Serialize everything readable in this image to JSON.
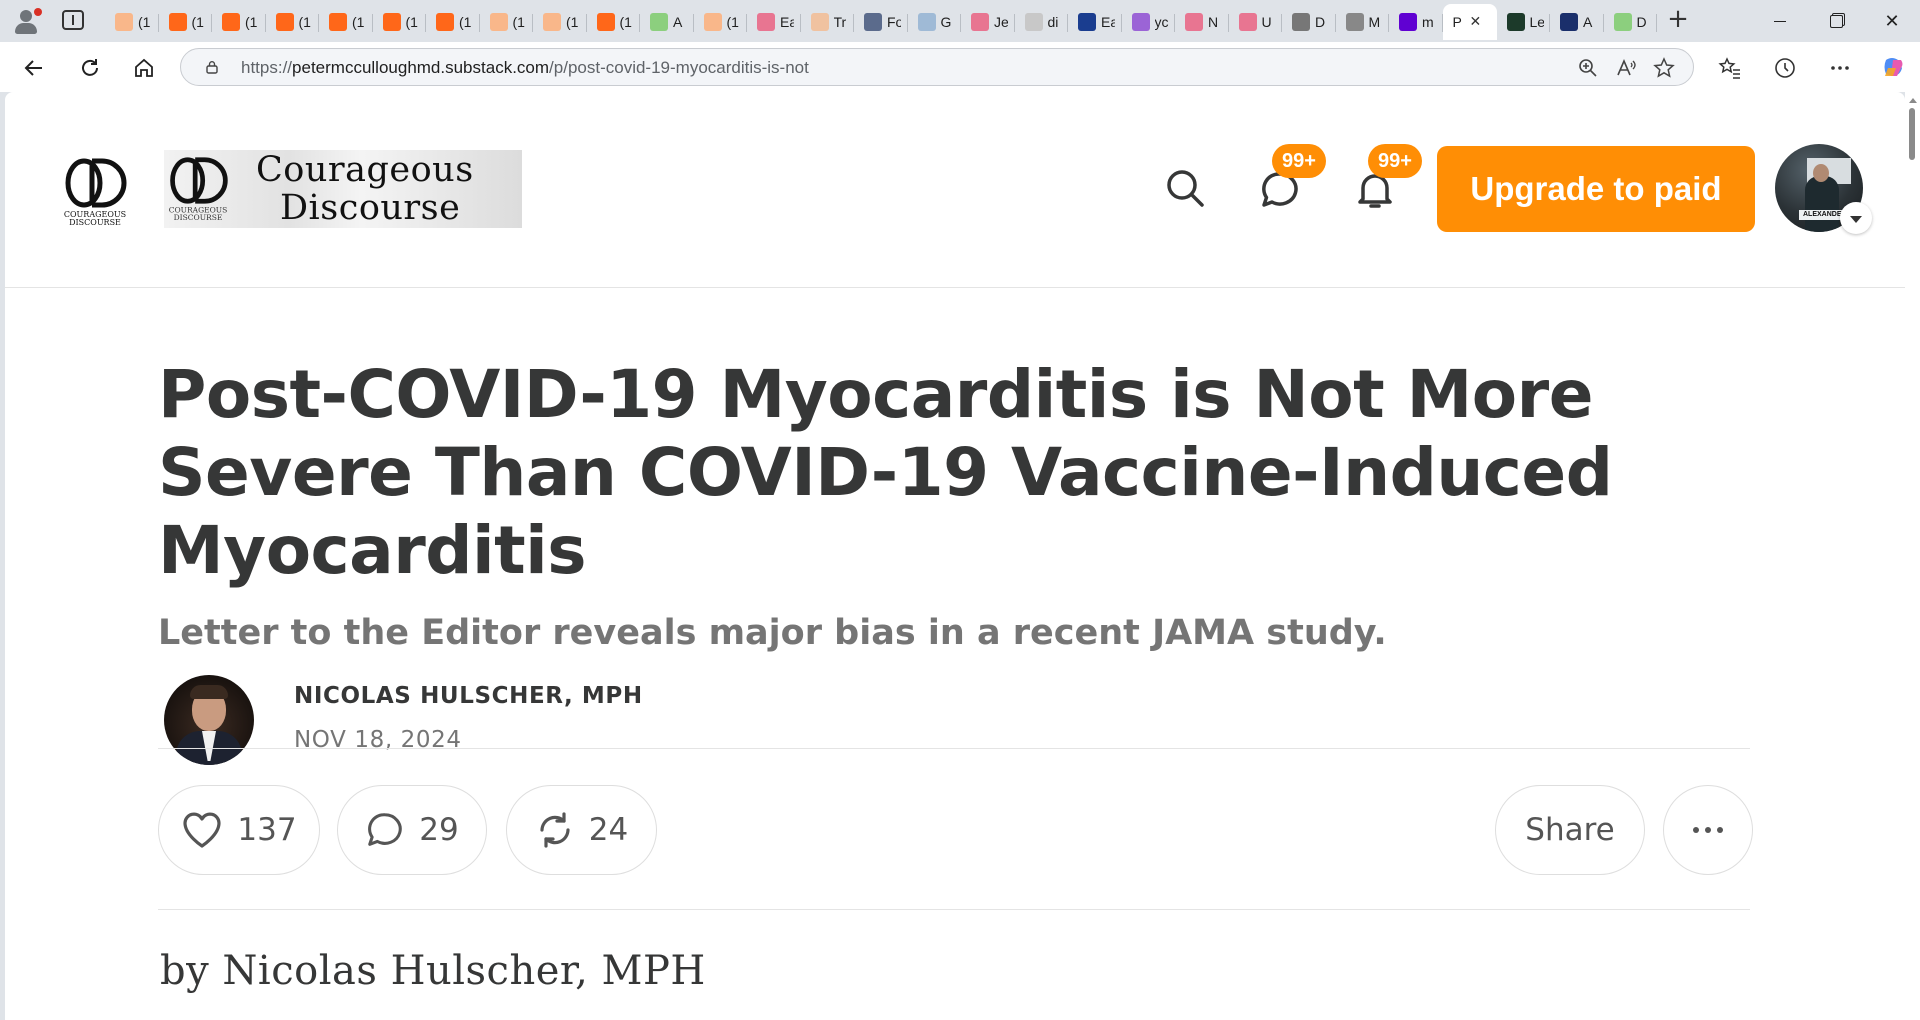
{
  "browser": {
    "tabs": [
      {
        "title": "(1",
        "fav": "#f9b78a"
      },
      {
        "title": "(1",
        "fav": "#ff6719"
      },
      {
        "title": "(1",
        "fav": "#ff6719"
      },
      {
        "title": "(1",
        "fav": "#ff6719"
      },
      {
        "title": "(1",
        "fav": "#ff6719"
      },
      {
        "title": "(1",
        "fav": "#ff6719"
      },
      {
        "title": "(1",
        "fav": "#ff6719"
      },
      {
        "title": "(1",
        "fav": "#f9b78a"
      },
      {
        "title": "(1",
        "fav": "#f9b78a"
      },
      {
        "title": "(1",
        "fav": "#ff6719"
      },
      {
        "title": "A",
        "fav": "#8ccf7e"
      },
      {
        "title": "(1",
        "fav": "#f9b78a"
      },
      {
        "title": "Ea",
        "fav": "#e87591"
      },
      {
        "title": "Tr",
        "fav": "#f0c2a0"
      },
      {
        "title": "Fo",
        "fav": "#5b6b8c"
      },
      {
        "title": "G",
        "fav": "#9fbad6"
      },
      {
        "title": "Je",
        "fav": "#e87591"
      },
      {
        "title": "di",
        "fav": "#c8c8c8"
      },
      {
        "title": "Ea",
        "fav": "#1a3d8f"
      },
      {
        "title": "yc",
        "fav": "#9b64d6"
      },
      {
        "title": "N",
        "fav": "#e87591"
      },
      {
        "title": "U",
        "fav": "#e87591"
      },
      {
        "title": "D",
        "fav": "#777777"
      },
      {
        "title": "M",
        "fav": "#888888"
      },
      {
        "title": "m",
        "fav": "#6001d2"
      },
      {
        "title": "P",
        "fav": "#ffffff",
        "active": true
      },
      {
        "title": "Le",
        "fav": "#1c3a2a"
      },
      {
        "title": "A",
        "fav": "#1a2f6b"
      },
      {
        "title": "D",
        "fav": "#8ccf7e"
      }
    ],
    "close_tab_glyph": "✕",
    "new_tab_glyph": "+",
    "window_close_glyph": "✕",
    "url_prefix": "https://",
    "url_host": "petermcculloughmd.substack.com",
    "url_path": "/p/post-covid-19-myocarditis-is-not"
  },
  "site": {
    "logo_line1": "Courageous",
    "logo_line2": "Discourse",
    "logo_mark_caption_1": "COURAGEOUS",
    "logo_mark_caption_2": "DISCOURSE",
    "chat_badge": "99+",
    "bell_badge": "99+",
    "upgrade_label": "Upgrade to paid",
    "avatar_banner": "ALEXANDER"
  },
  "article": {
    "title": "Post-COVID-19 Myocarditis is Not More Severe Than COVID-19 Vaccine-Induced Myocarditis",
    "subtitle": "Letter to the Editor reveals major bias in a recent JAMA study.",
    "author": "NICOLAS HULSCHER, MPH",
    "date": "NOV 18, 2024",
    "likes": "137",
    "comments": "29",
    "restacks": "24",
    "share_label": "Share",
    "body_byline": "by Nicolas Hulscher, MPH"
  },
  "colors": {
    "accent": "#ff8e05",
    "title_text": "#363737",
    "muted_text": "#757575"
  }
}
